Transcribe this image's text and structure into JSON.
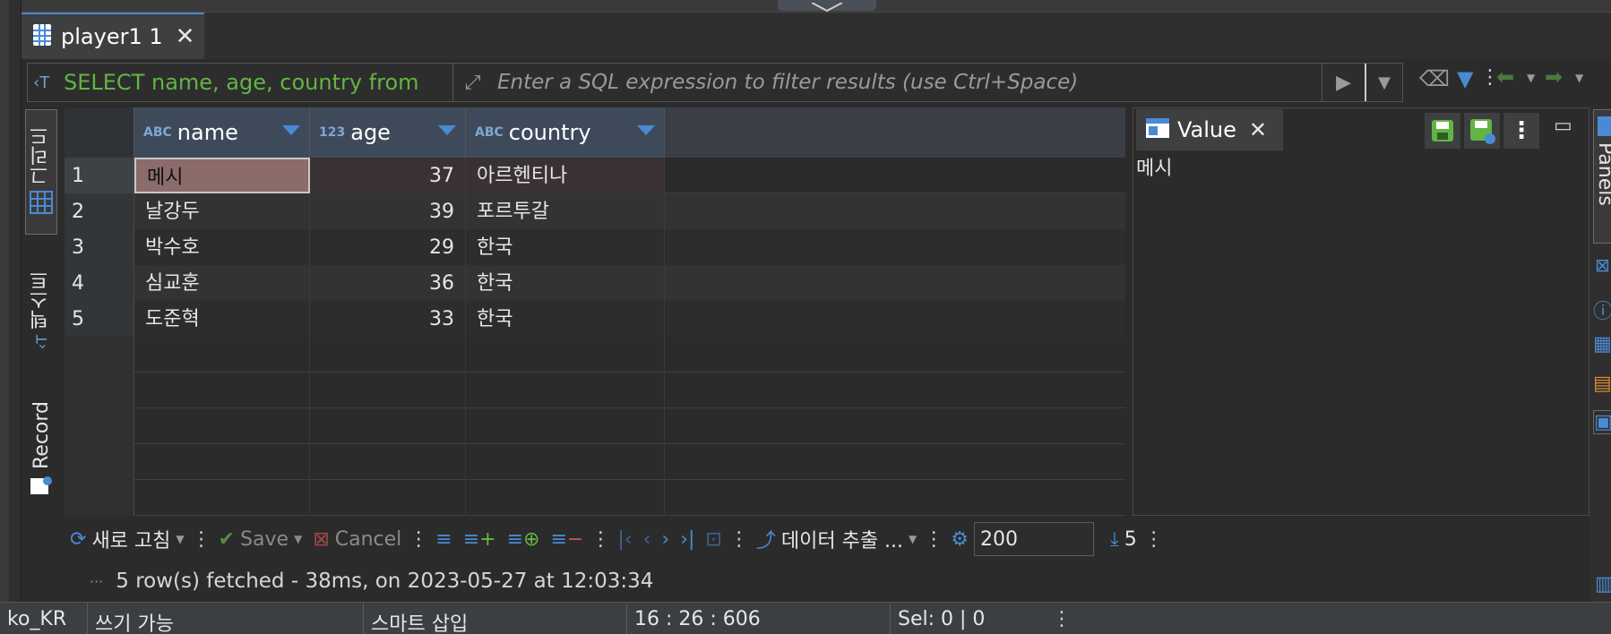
{
  "editor_tab": {
    "label": "player1 1",
    "close": "✕"
  },
  "filter": {
    "sql": "SELECT name, age, country from",
    "placeholder": "Enter a SQL expression to filter results (use Ctrl+Space)"
  },
  "side_tabs": {
    "grid": "그리드",
    "text": "텍스트",
    "record": "Record"
  },
  "grid": {
    "columns": [
      {
        "type": "ABC",
        "name": "name"
      },
      {
        "type": "123",
        "name": "age"
      },
      {
        "type": "ABC",
        "name": "country"
      }
    ],
    "rows": [
      {
        "num": "1",
        "name": "메시",
        "age": "37",
        "country": "아르헨티나"
      },
      {
        "num": "2",
        "name": "날강두",
        "age": "39",
        "country": "포르투갈"
      },
      {
        "num": "3",
        "name": "박수호",
        "age": "29",
        "country": "한국"
      },
      {
        "num": "4",
        "name": "심교훈",
        "age": "36",
        "country": "한국"
      },
      {
        "num": "5",
        "name": "도준혁",
        "age": "33",
        "country": "한국"
      }
    ],
    "selected_row": 1
  },
  "value_panel": {
    "tab_label": "Value",
    "content": "메시"
  },
  "panels_label": "Panels",
  "bottom_toolbar": {
    "refresh": "새로 고침",
    "save": "Save",
    "cancel": "Cancel",
    "export": "데이터 추출 ...",
    "limit": "200",
    "row_count": "5"
  },
  "status_line": "5 row(s) fetched - 38ms, on 2023-05-27 at 12:03:34",
  "status_bar": {
    "locale": "ko_KR",
    "writable": "쓰기 가능",
    "insert_mode": "스마트 삽입",
    "position": "16 : 26 : 606",
    "selection": "Sel: 0 | 0"
  },
  "colors": {
    "accent": "#4a8ad4",
    "sql_green": "#62b543",
    "header_bg": "#3e4a5a",
    "selected_cell": "#8c6b6b"
  }
}
